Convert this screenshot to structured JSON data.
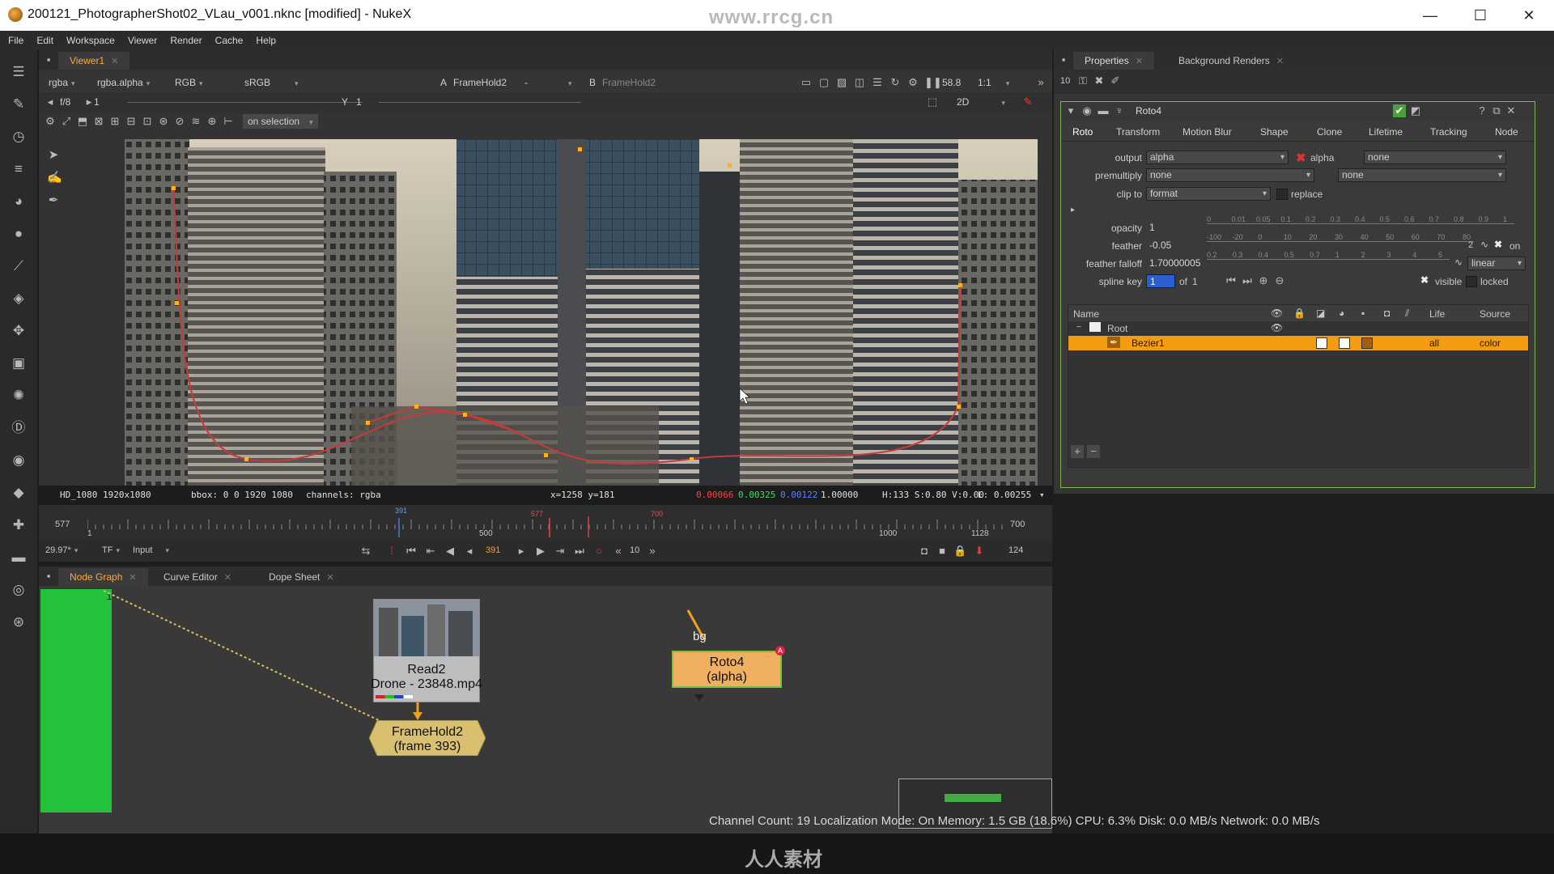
{
  "window": {
    "title": "200121_PhotographerShot02_VLau_v001.nknc [modified] - NukeX",
    "watermark_url": "www.rrcg.cn",
    "controls": [
      "—",
      "☐",
      "✕"
    ]
  },
  "menu": [
    "File",
    "Edit",
    "Workspace",
    "Viewer",
    "Render",
    "Cache",
    "Help"
  ],
  "viewer": {
    "tab": "Viewer1",
    "toolbar": {
      "channels": "rgba",
      "channel_layer": "rgba.alpha",
      "display": "RGB",
      "lut": "sRGB",
      "input_a_label": "A",
      "input_a": "FrameHold2",
      "wipe": "-",
      "input_b_label": "B",
      "input_b": "FrameHold2",
      "gain": "58.8",
      "zoom": "1:1",
      "fstop": "f/8",
      "frame_a": "1",
      "y_label": "Y",
      "y_value": "1",
      "mode": "2D",
      "roto_mode": "on selection"
    },
    "status": {
      "format": "HD_1080 1920x1080",
      "bbox": "bbox: 0 0 1920 1080",
      "channels": "channels: rgba",
      "coords": "x=1258 y=181",
      "r": "0.00066",
      "g": "0.00325",
      "b": "0.00122",
      "a": "1.00000",
      "hsv": "H:133 S:0.80 V:0.00",
      "l": "L: 0.00255"
    },
    "timeline": {
      "in_frame": "577",
      "start": "1",
      "tick_500": "500",
      "tick_1000": "1000",
      "end": "1128",
      "out_frame": "700",
      "marker_current": "391",
      "marker_in": "577",
      "marker_out": "700",
      "fps": "29.97*",
      "tf": "TF",
      "input": "Input",
      "current_frame": "391",
      "step": "10",
      "frame_count": "124"
    }
  },
  "nodegraph": {
    "tabs": [
      "Node Graph",
      "Curve Editor",
      "Dope Sheet"
    ],
    "nodes": {
      "read": {
        "line1": "Read2",
        "line2": "Drone - 23848.mp4"
      },
      "framehold": {
        "line1": "FrameHold2",
        "line2": "(frame 393)"
      },
      "roto": {
        "line1": "Roto4",
        "line2": "(alpha)",
        "input_label": "bg",
        "badge": "A"
      }
    },
    "backdrop_label": "1",
    "status": "Channel Count: 19 Localization Mode: On Memory: 1.5 GB (18.6%) CPU: 6.3% Disk: 0.0 MB/s Network: 0.0 MB/s"
  },
  "properties": {
    "tabs": [
      "Properties",
      "Background Renders"
    ],
    "max_panels": "10",
    "node_name": "Roto4",
    "subtabs": [
      "Roto",
      "Transform",
      "Motion Blur",
      "Shape",
      "Clone",
      "Lifetime",
      "Tracking",
      "Node"
    ],
    "output": {
      "label": "output",
      "value": "alpha",
      "check_label": "alpha",
      "extra": "none"
    },
    "premultiply": {
      "label": "premultiply",
      "value": "none",
      "extra": "none"
    },
    "clip_to": {
      "label": "clip to",
      "value": "format",
      "check_label": "replace"
    },
    "opacity": {
      "label": "opacity",
      "value": "1",
      "ticks": [
        "0",
        "0.01",
        "0.05",
        "0.1",
        "0.2",
        "0.3",
        "0.4",
        "0.5",
        "0.6",
        "0.7",
        "0.8",
        "0.9",
        "1"
      ]
    },
    "feather": {
      "label": "feather",
      "value": "-0.05",
      "ticks": [
        "-100",
        "-20",
        "0",
        "10",
        "20",
        "30",
        "40",
        "50",
        "60",
        "70",
        "80"
      ],
      "count": "2",
      "on_label": "on"
    },
    "feather_falloff": {
      "label": "feather falloff",
      "value": "1.70000005",
      "ticks": [
        "0.2",
        "0.3",
        "0.4",
        "0.5",
        "0.7",
        "1",
        "2",
        "3",
        "4",
        "5"
      ],
      "curve": "linear"
    },
    "spline_key": {
      "label": "spline key",
      "value": "1",
      "of_label": "of",
      "of_value": "1",
      "visible": "visible",
      "locked": "locked"
    },
    "table": {
      "headers": [
        "Name",
        "Life",
        "Source"
      ],
      "rows": [
        {
          "name": "Root"
        },
        {
          "name": "Bezier1",
          "life": "all",
          "source": "color"
        }
      ]
    }
  },
  "bottom_watermark": "人人素材"
}
